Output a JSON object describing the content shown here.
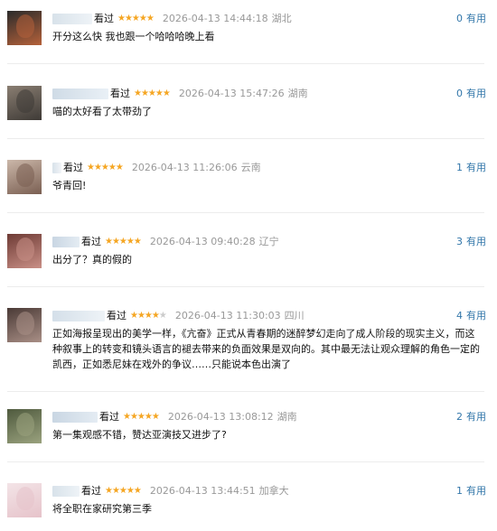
{
  "comments": [
    {
      "watched": "看过",
      "stars": "★★★★★",
      "time": "2026-04-13 14:44:18",
      "location": "湖北",
      "votes": "0",
      "useful": "有用",
      "text": "开分这么快 我也跟一个哈哈哈晚上看",
      "avatar_colors": [
        "#2b2b2b",
        "#b5613a"
      ],
      "name_colors": [
        "#d8e2ea",
        "#eef3f7"
      ]
    },
    {
      "watched": "看过",
      "stars": "★★★★★",
      "time": "2026-04-13 15:47:26",
      "location": "湖南",
      "votes": "0",
      "useful": "有用",
      "text": "喵的太好看了太带劲了",
      "avatar_colors": [
        "#8a7e72",
        "#3e3a36"
      ],
      "name_colors": [
        "#cfdbe6",
        "#e9f0f6"
      ]
    },
    {
      "watched": "看过",
      "stars": "★★★★★",
      "time": "2026-04-13 11:26:06",
      "location": "云南",
      "votes": "1",
      "useful": "有用",
      "text": "爷青回!",
      "avatar_colors": [
        "#cbb7a9",
        "#7a5f52"
      ],
      "name_colors": [
        "#d8e2ea",
        "#f2f5f8"
      ]
    },
    {
      "watched": "看过",
      "stars": "★★★★★",
      "time": "2026-04-13 09:40:28",
      "location": "辽宁",
      "votes": "3",
      "useful": "有用",
      "text": "出分了？真的假的",
      "avatar_colors": [
        "#6e3b35",
        "#c98f86"
      ],
      "name_colors": [
        "#c9d6e3",
        "#e4ecf3"
      ]
    },
    {
      "watched": "看过",
      "stars": "★★★★",
      "stars_off": "★",
      "time": "2026-04-13 11:30:03",
      "location": "四川",
      "votes": "4",
      "useful": "有用",
      "text": "正如海报呈现出的美学一样，《亢奋》正式从青春期的迷醉梦幻走向了成人阶段的现实主义，而这种叙事上的转变和镜头语言的褪去带来的负面效果是双向的。其中最无法让观众理解的角色一定的凯西，正如悉尼妹在戏外的争议……只能说本色出演了",
      "avatar_colors": [
        "#4a3a36",
        "#a98f86"
      ],
      "name_colors": [
        "#d4dfe9",
        "#eef3f7"
      ]
    },
    {
      "watched": "看过",
      "stars": "★★★★★",
      "time": "2026-04-13 13:08:12",
      "location": "湖南",
      "votes": "2",
      "useful": "有用",
      "text": "第一集观感不错，赞达亚演技又进步了?",
      "avatar_colors": [
        "#4f5a3e",
        "#9aa27e"
      ],
      "name_colors": [
        "#c9d6e3",
        "#e4ecf3"
      ]
    },
    {
      "watched": "看过",
      "stars": "★★★★★",
      "time": "2026-04-13 13:44:51",
      "location": "加拿大",
      "votes": "1",
      "useful": "有用",
      "text": "将全职在家研究第三季",
      "avatar_colors": [
        "#f3e4e7",
        "#e6c3ca"
      ],
      "name_colors": [
        "#d8e2ea",
        "#eef3f7"
      ]
    }
  ]
}
